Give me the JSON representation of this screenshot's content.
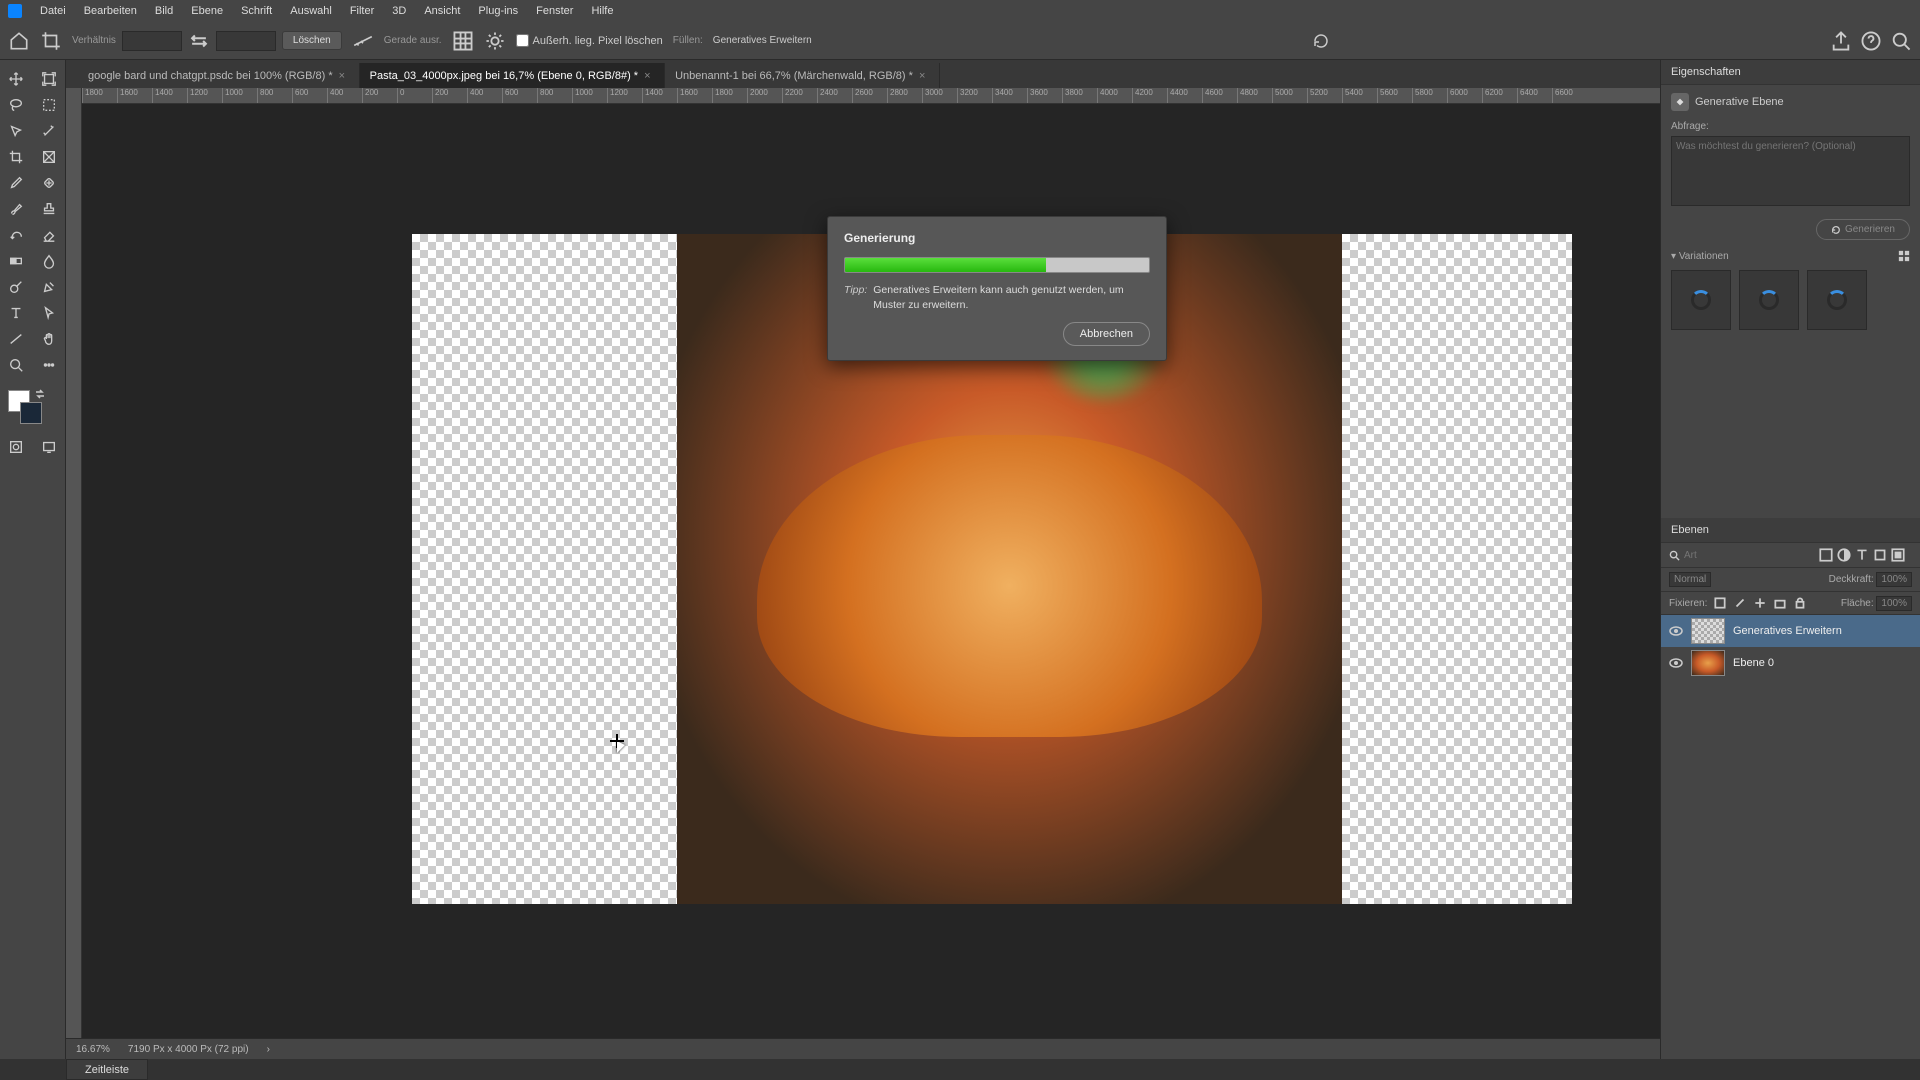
{
  "menu": [
    "Datei",
    "Bearbeiten",
    "Bild",
    "Ebene",
    "Schrift",
    "Auswahl",
    "Filter",
    "3D",
    "Ansicht",
    "Plug-ins",
    "Fenster",
    "Hilfe"
  ],
  "options": {
    "ratio_label": "Verhältnis",
    "w": "",
    "h": "",
    "clear_btn": "Löschen",
    "straighten": "Gerade ausr.",
    "delete_cropped": "Außerh. lieg. Pixel löschen",
    "fill_label": "Füllen:",
    "fill_value": "Generatives Erweitern"
  },
  "tabs": [
    {
      "label": "google bard und chatgpt.psdc bei 100% (RGB/8) *",
      "active": false
    },
    {
      "label": "Pasta_03_4000px.jpeg bei 16,7% (Ebene 0, RGB/8#) *",
      "active": true
    },
    {
      "label": "Unbenannt-1 bei 66,7% (Märchenwald, RGB/8) *",
      "active": false
    }
  ],
  "ruler_ticks": [
    "1800",
    "1600",
    "1400",
    "1200",
    "1000",
    "800",
    "600",
    "400",
    "200",
    "0",
    "200",
    "400",
    "600",
    "800",
    "1000",
    "1200",
    "1400",
    "1600",
    "1800",
    "2000",
    "2200",
    "2400",
    "2600",
    "2800",
    "3000",
    "3200",
    "3400",
    "3600",
    "3800",
    "4000",
    "4200",
    "4400",
    "4600",
    "4800",
    "5000",
    "5200",
    "5400",
    "5600",
    "5800",
    "6000",
    "6200",
    "6400",
    "6600"
  ],
  "dialog": {
    "title": "Generierung",
    "tip_label": "Tipp:",
    "tip_text": "Generatives Erweitern kann auch genutzt werden, um Muster zu erweitern.",
    "cancel": "Abbrechen",
    "progress_pct": 66
  },
  "properties": {
    "panel_title": "Eigenschaften",
    "layer_type": "Generative Ebene",
    "prompt_label": "Abfrage:",
    "prompt_placeholder": "Was möchtest du generieren? (Optional)",
    "generate_btn": "Generieren",
    "variations_label": "Variationen"
  },
  "layers_panel": {
    "title": "Ebenen",
    "search_placeholder": "Art",
    "blend_mode": "Normal",
    "opacity_label": "Deckkraft:",
    "opacity_value": "100%",
    "lock_label": "Fixieren:",
    "fill_label": "Fläche:",
    "fill_value": "100%",
    "layers": [
      {
        "name": "Generatives Erweitern",
        "selected": true,
        "thumb": "transp"
      },
      {
        "name": "Ebene 0",
        "selected": false,
        "thumb": "image"
      }
    ]
  },
  "status": {
    "zoom": "16.67%",
    "docinfo": "7190 Px x 4000 Px (72 ppi)"
  },
  "timeline_tab": "Zeitleiste"
}
